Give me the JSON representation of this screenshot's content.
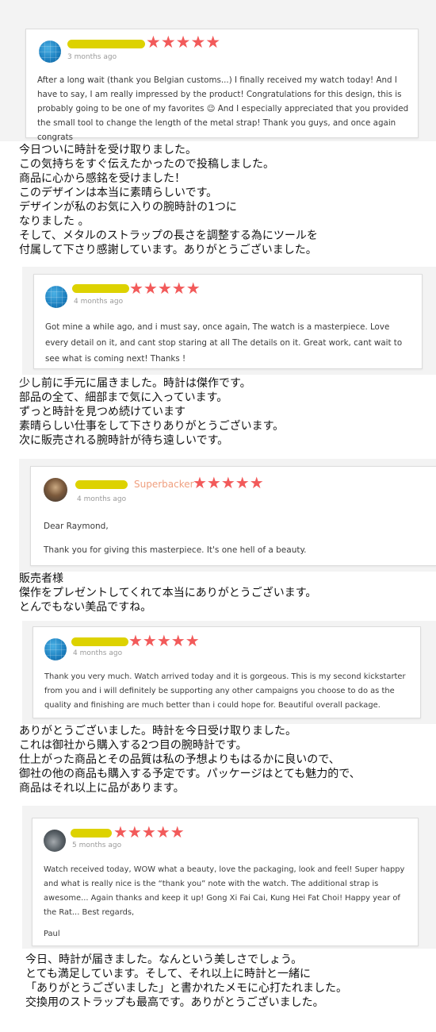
{
  "colors": {
    "star": "#f25a5a",
    "name_highlight": "#ddd200",
    "badge": "#f0a080",
    "time_text": "#9a9a9a",
    "review_text": "#3a3a3a",
    "card_border": "#dcdcdc"
  },
  "reviews": [
    {
      "avatar": "blue-grid-avatar",
      "stars": "★★★★★",
      "time": "3 months ago",
      "text": "After a long wait (thank you Belgian customs...) I finally received my watch today! And I have to say, I am really impressed by the product! Congratulations for this design, this is probably going to be one of my favorites 😉 And I especially appreciated that you provided the small tool to change the length of the metal strap! Thank you guys, and once again congrats",
      "translation": "今日ついに時計を受け取りました。\nこの気持ちをすぐ伝えたかったので投稿しました。\n商品に心から感銘を受けました！\nこのデザインは本当に素晴らしいです。\nデザインが私のお気に入りの腕時計の1つに\nなりました 。\nそして、メタルのストラップの長さを調整する為にツールを\n付属して下さり感謝しています。ありがとうございました。"
    },
    {
      "avatar": "blue-grid-avatar",
      "stars": "★★★★★",
      "time": "4 months ago",
      "text": "Got mine a while ago, and i must say, once again, The watch is a masterpiece. Love every detail on it, and cant stop staring at all The details on it. Great work, cant wait to see what is coming next! Thanks !",
      "translation": "少し前に手元に届きました。時計は傑作です。\n部品の全て、細部まで気に入っています。\nずっと時計を見つめ続けています\n素晴らしい仕事をして下さりありがとうございます。\n次に販売される腕時計が待ち遠しいです。"
    },
    {
      "avatar": "photo-avatar",
      "badge": "Superbacker",
      "stars": "★★★★★",
      "time": "4 months ago",
      "text_lines": [
        "Dear Raymond,",
        "Thank you for giving this masterpiece. It's one hell of a beauty."
      ],
      "translation": "販売者様\n傑作をプレゼントしてくれて本当にありがとうございます。\nとんでもない美品ですね。"
    },
    {
      "avatar": "blue-grid-avatar",
      "stars": "★★★★★",
      "time": "4 months ago",
      "text": "Thank you very much. Watch arrived today and it is gorgeous. This is my second kickstarter from you and i will definitely be supporting any other campaigns you choose to do as the quality and finishing are much better than i could hope for. Beautiful overall package.",
      "translation": "ありがとうございました。時計を今日受け取りました。\nこれは御社から購入する2つ目の腕時計です。\n仕上がった商品とその品質は私の予想よりもはるかに良いので、\n御社の他の商品も購入する予定です。パッケージはとても魅力的で、\n商品はそれ以上に品があります。"
    },
    {
      "avatar": "photo-avatar",
      "stars": "★★★★★",
      "time": "5 months ago",
      "text": "Watch received today, WOW what a beauty, love the packaging, look and feel! Super happy and what is really nice is the “thank you” note with the watch. The additional strap is awesome... Again thanks and keep it up! Gong Xi Fai Cai, Kung Hei Fat Choi! Happy year of the Rat... Best regards,",
      "signature": "Paul",
      "translation": "今日、時計が届きました。なんという美しさでしょう。\nとても満足しています。そして、それ以上に時計と一緒に\n「ありがとうございました」と書かれたメモに心打たれました。\n交換用のストラップも最高です。ありがとうございました。"
    }
  ]
}
